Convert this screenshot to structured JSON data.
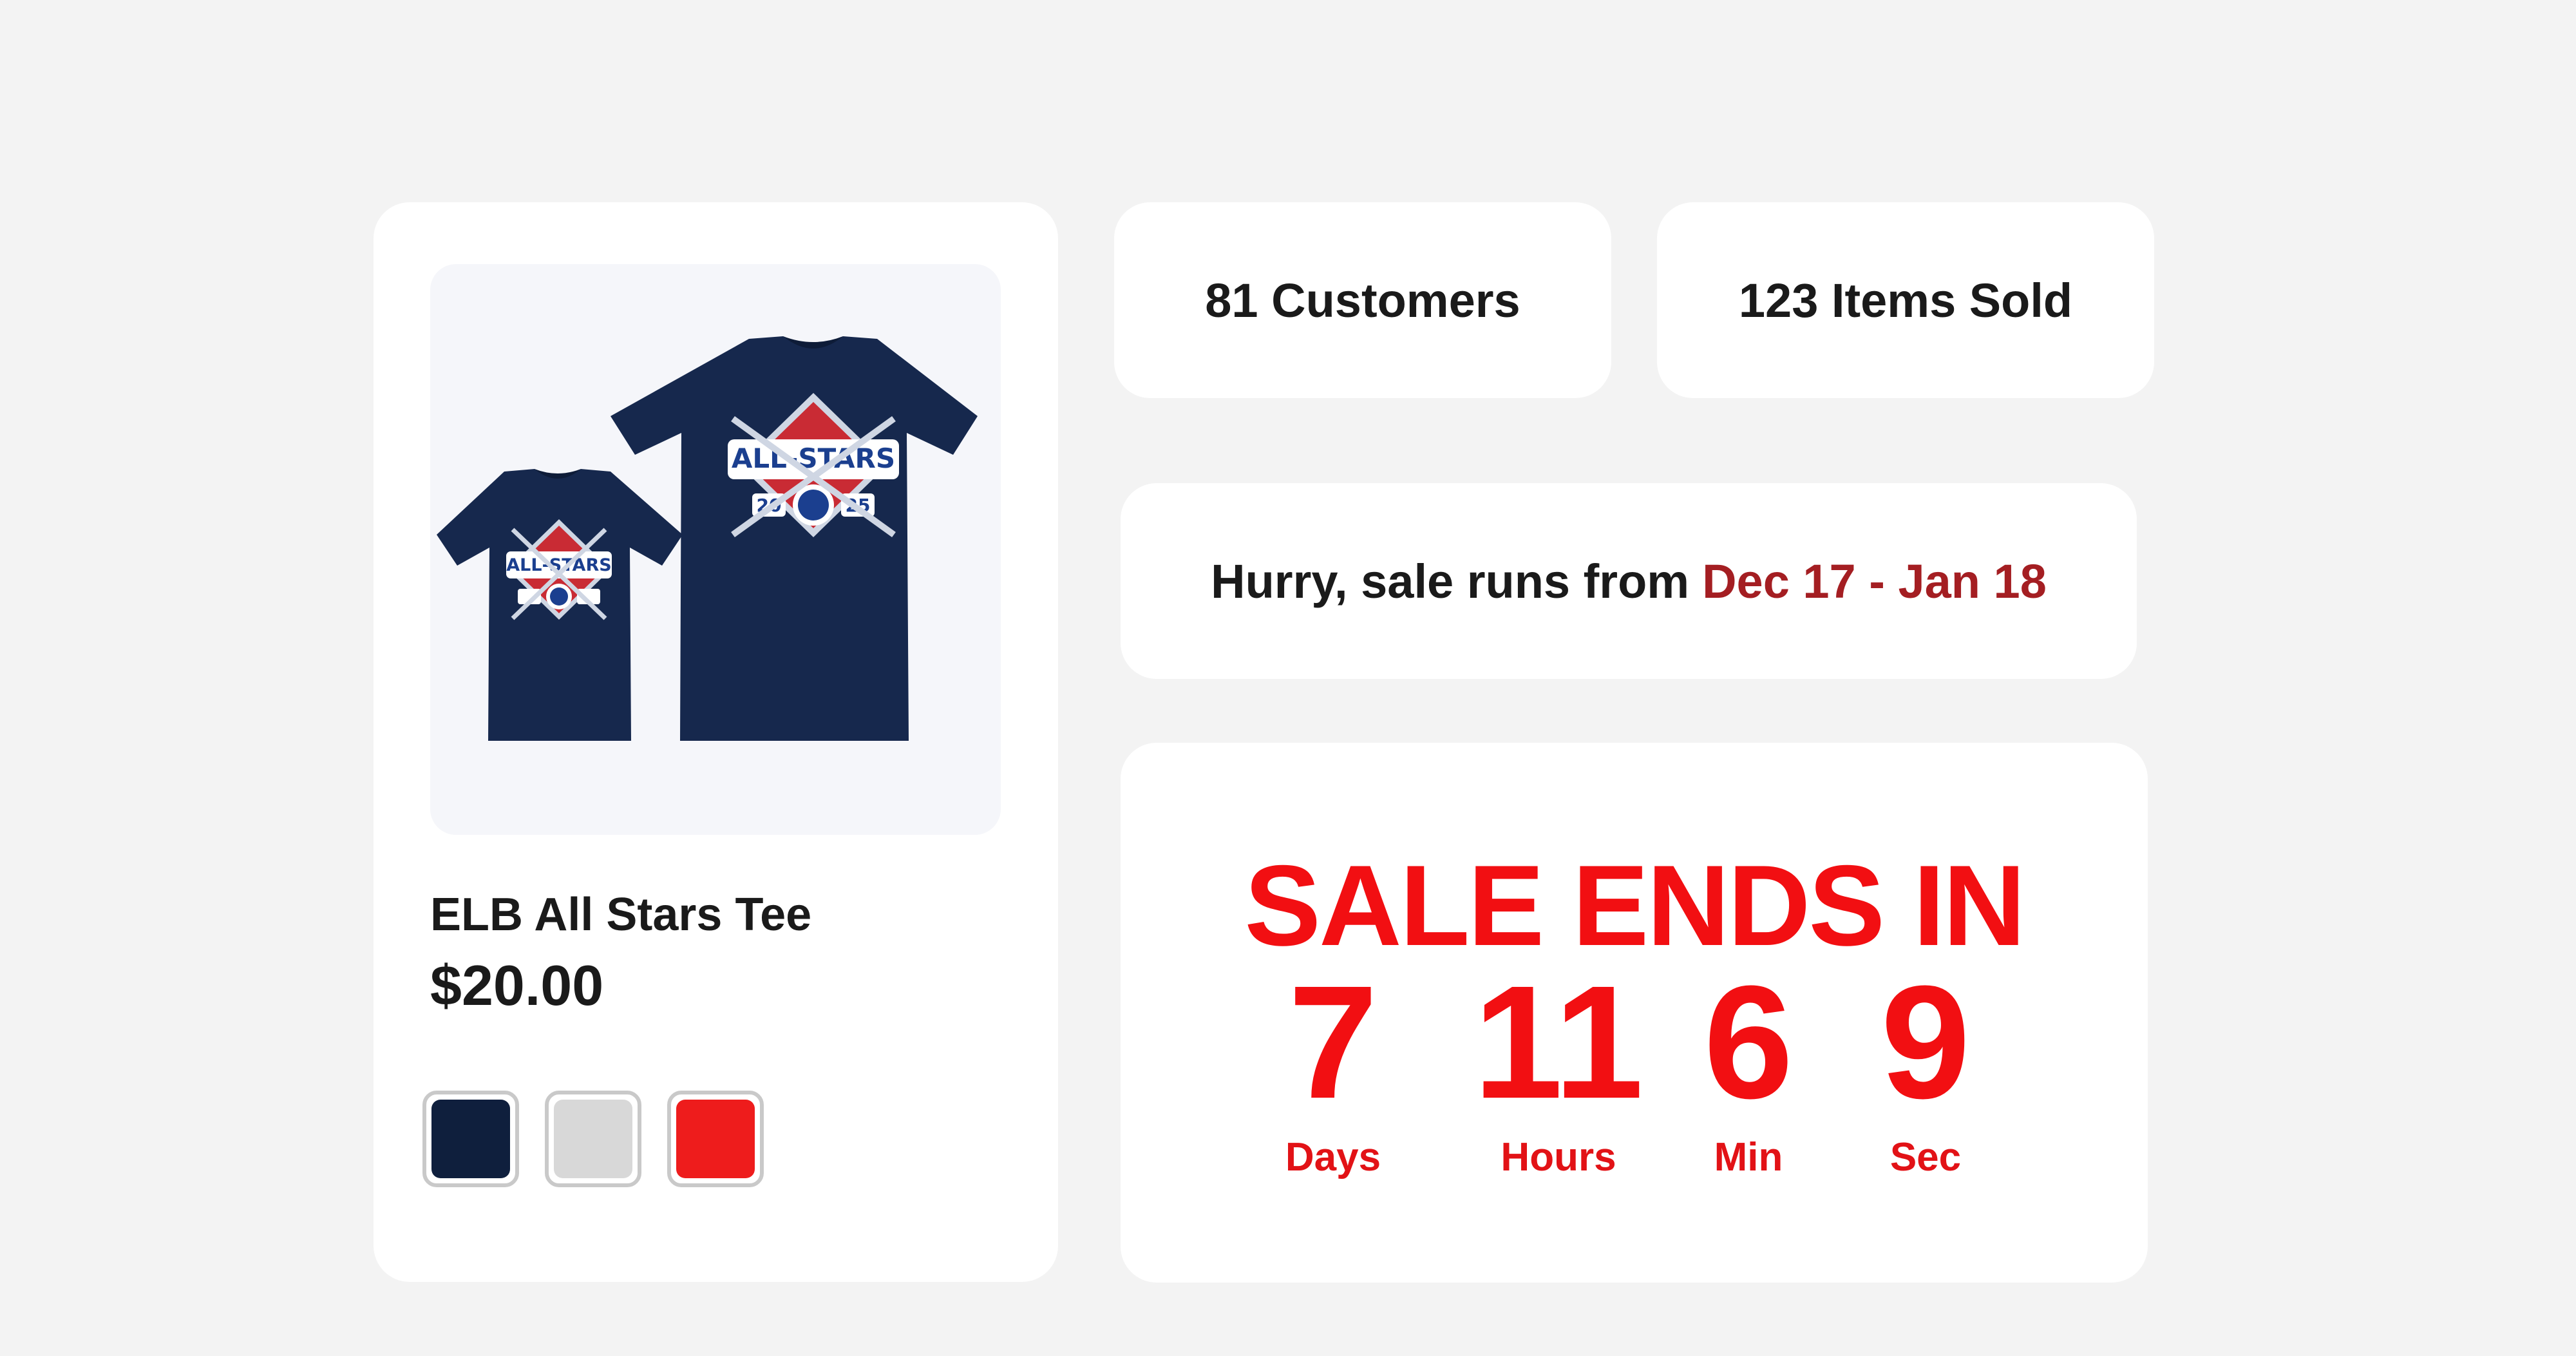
{
  "product": {
    "name": "ELB All Stars Tee",
    "price": "$20.00",
    "image_alt": "ALL-STARS 2025",
    "swatches": [
      {
        "name": "navy",
        "color": "#0f1f3d"
      },
      {
        "name": "light-gray",
        "color": "#d8d8d8"
      },
      {
        "name": "red",
        "color": "#ee1c1c"
      }
    ]
  },
  "stats": {
    "customers": "81 Customers",
    "items_sold": "123 Items Sold"
  },
  "sale": {
    "prefix": "Hurry, sale runs from",
    "range": "Dec 17 - Jan 18"
  },
  "countdown": {
    "title": "SALE ENDS IN",
    "units": [
      {
        "value": "7",
        "label": "Days"
      },
      {
        "value": "11",
        "label": "Hours"
      },
      {
        "value": "6",
        "label": "Min"
      },
      {
        "value": "9",
        "label": "Sec"
      }
    ]
  },
  "colors": {
    "accent_red": "#f20f12",
    "date_red": "#a41e22",
    "shirt_navy": "#16284d"
  }
}
